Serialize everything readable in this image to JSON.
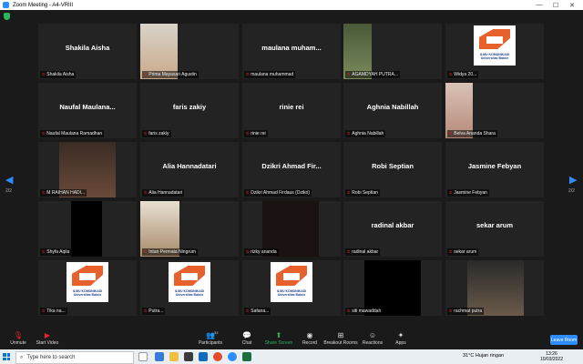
{
  "window": {
    "title": "Zoom Meeting - A4-VRIII",
    "controls": [
      "—",
      "☐",
      "✕"
    ]
  },
  "pagination": {
    "left": "2/2",
    "right": "2/2"
  },
  "tiles": [
    {
      "big": "Shakila Aisha",
      "label": "Shakila Aisha"
    },
    {
      "big": "",
      "label": "Prima Mayasari Agustin"
    },
    {
      "big": "maulana  muham...",
      "label": "maulana muhammad"
    },
    {
      "big": "",
      "label": "AGAMDYAH PUTRA..."
    },
    {
      "big": "",
      "label": "Widya 20..."
    },
    {
      "big": "Naufal  Maulana...",
      "label": "Naufal Maulana Ramadhan"
    },
    {
      "big": "faris zakiy",
      "label": "faris zakiy"
    },
    {
      "big": "rinie rei",
      "label": "rinie rei"
    },
    {
      "big": "Aghnia Nabillah",
      "label": "Aghnia Nabillah"
    },
    {
      "big": "",
      "label": "Belva Ananda Shara"
    },
    {
      "big": "",
      "label": "M.RAIHAN HADI..."
    },
    {
      "big": "Alia Hannadatari",
      "label": "Alia Hannadatari"
    },
    {
      "big": "Dzikri  Ahmad  Fir...",
      "label": "Dzikri Ahmad Firdaus (Dzikri)"
    },
    {
      "big": "Robi Septian",
      "label": "Robi Septian"
    },
    {
      "big": "Jasmine Febyan",
      "label": "Jasmine Febyan"
    },
    {
      "big": "",
      "label": "Shyfa Aqila"
    },
    {
      "big": "",
      "label": "Intan Permata Ningrum"
    },
    {
      "big": "",
      "label": "rizky ananda"
    },
    {
      "big": "radinal akbar",
      "label": "radinal akbar"
    },
    {
      "big": "sekar arum",
      "label": "sekar arum"
    },
    {
      "big": "",
      "label": "Tika na..."
    },
    {
      "big": "",
      "label": "Putra..."
    },
    {
      "big": "",
      "label": "Safana..."
    },
    {
      "big": "",
      "label": "siti mawaddah"
    },
    {
      "big": "",
      "label": "rachmat putra"
    }
  ],
  "logo_text": "ILMU KOMUNIKASI\nUniversitas Bakrie",
  "toolbar": {
    "unmute": "Unmute",
    "start_video": "Start Video",
    "participants": "Participants",
    "participants_count": "33",
    "chat": "Chat",
    "share_screen": "Share Screen",
    "record": "Record",
    "breakout": "Breakout Rooms",
    "reactions": "Reactions",
    "apps": "Apps",
    "leave": "Leave Room"
  },
  "taskbar": {
    "search_placeholder": "Type here to search",
    "weather": "31°C  Hujan ringan",
    "time": "13:26",
    "date": "10/03/2022"
  },
  "colors": {
    "accent": "#2d8cff",
    "logo_orange": "#e8602c",
    "mic_muted": "#e02828",
    "share_green": "#2db55d"
  }
}
